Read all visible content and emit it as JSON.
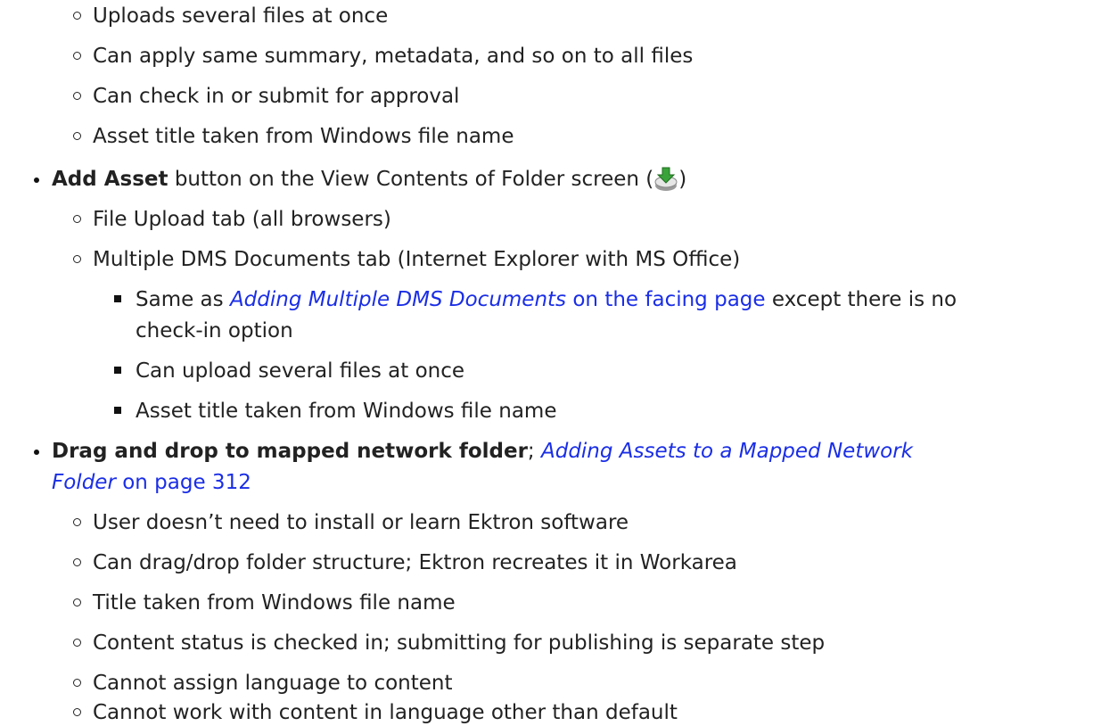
{
  "top_items": [
    {
      "text": "Uploads several files at once"
    },
    {
      "text": "Can apply same summary, metadata, and so on to all files"
    },
    {
      "text": "Can check in or submit for approval"
    },
    {
      "text": "Asset title taken from Windows file name"
    }
  ],
  "add_asset": {
    "bold": "Add Asset",
    "text": " button on the View Contents of Folder screen (",
    "text_end": ")",
    "icon": "add-asset-icon",
    "sub": {
      "file_upload": "File Upload tab (all browsers)",
      "multiple_dms": "Multiple DMS Documents tab (Internet Explorer with MS Office)",
      "same_as": {
        "prefix": "Same as ",
        "link_italic": "Adding Multiple DMS Documents",
        "link_rest": " on the facing page",
        "suffix": " except there is no",
        "cont": "check-in option"
      },
      "can_upload": "Can upload several files at once",
      "asset_title": "Asset title taken from Windows file name"
    }
  },
  "drag_drop": {
    "bold": "Drag and drop to mapped network folder",
    "sep": "; ",
    "link_italic_1": "Adding Assets to a Mapped Network",
    "link_italic_2": "Folder",
    "link_page": " on page 312",
    "items": [
      {
        "text": "User doesn’t need to install or learn Ektron software"
      },
      {
        "text": "Can drag/drop folder structure; Ektron recreates it in Workarea"
      },
      {
        "text": "Title taken from Windows file name"
      },
      {
        "text": "Content status is checked in; submitting for publishing is separate step"
      },
      {
        "text": "Cannot assign language to content"
      },
      {
        "text": "Cannot work with content in language other than default"
      }
    ]
  },
  "colors": {
    "text": "#222222",
    "link": "#1a2ee6"
  }
}
